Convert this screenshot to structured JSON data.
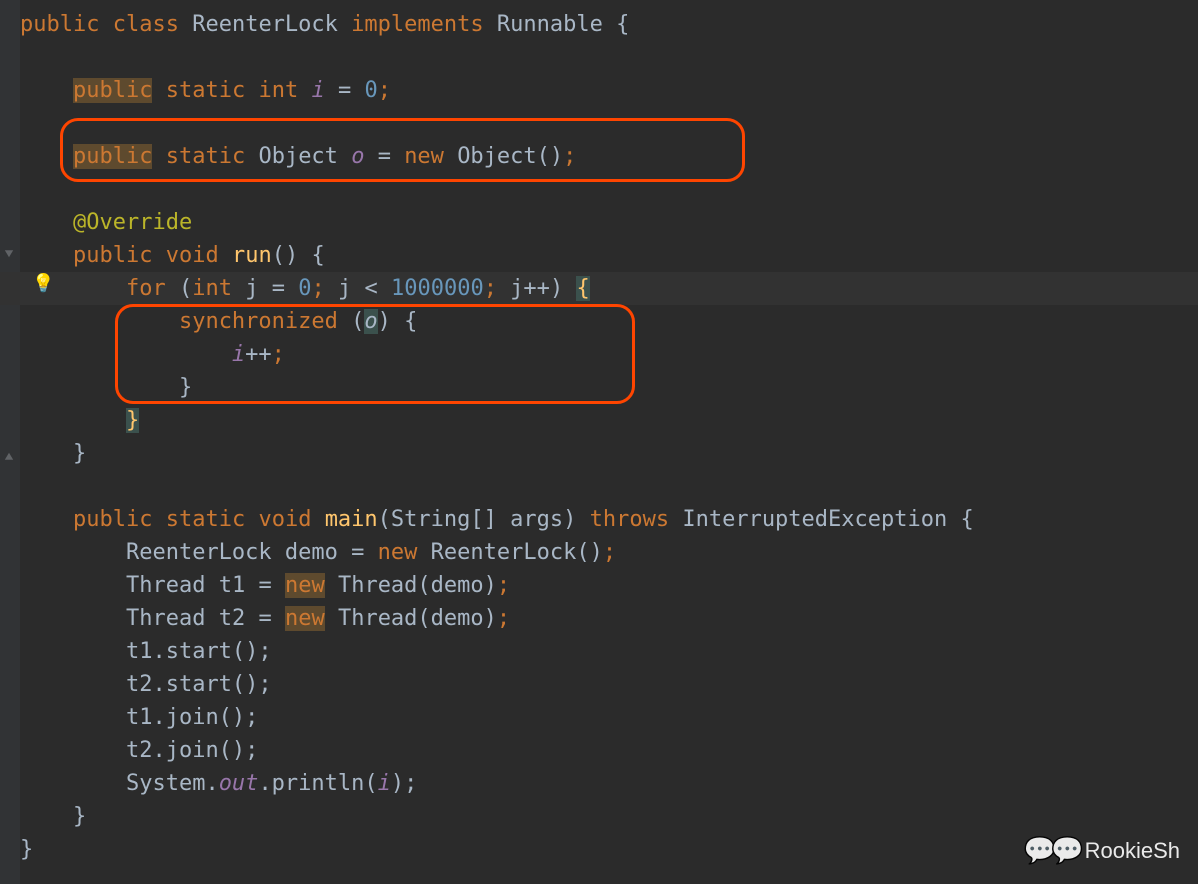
{
  "code": {
    "line1": {
      "kw_public": "public",
      "kw_class": "class",
      "class_name": "ReenterLock",
      "kw_implements": "implements",
      "iface": "Runnable",
      "brace": "{"
    },
    "line3": {
      "kw_public": "public",
      "kw_static": "static",
      "type": "int",
      "name": "i",
      "eq": "=",
      "val": "0",
      "semi": ";"
    },
    "line5": {
      "kw_public": "public",
      "kw_static": "static",
      "type": "Object",
      "name": "o",
      "eq": "=",
      "kw_new": "new",
      "ctor": "Object()",
      "semi": ";"
    },
    "line7": {
      "annotation": "@Override"
    },
    "line8": {
      "kw_public": "public",
      "kw_void": "void",
      "method": "run",
      "parens": "()",
      "brace": "{"
    },
    "line9": {
      "kw_for": "for",
      "open": "(",
      "kw_int": "int",
      "var": "j",
      "eq": "=",
      "zero": "0",
      "semi1": ";",
      "cond_var": "j",
      "lt": "<",
      "limit": "1000000",
      "semi2": ";",
      "inc": "j++",
      "close": ")",
      "brace": "{"
    },
    "line10": {
      "kw_sync": "synchronized",
      "open": "(",
      "var": "o",
      "close": ")",
      "brace": "{"
    },
    "line11": {
      "var": "i",
      "inc": "++",
      "semi": ";"
    },
    "line12": {
      "brace": "}"
    },
    "line13": {
      "brace": "}"
    },
    "line14": {
      "brace": "}"
    },
    "line16": {
      "kw_public": "public",
      "kw_static": "static",
      "kw_void": "void",
      "method": "main",
      "params": "(String[] args)",
      "kw_throws": "throws",
      "exc": "InterruptedException",
      "brace": "{"
    },
    "line17": {
      "type": "ReenterLock",
      "var": "demo",
      "eq": "=",
      "kw_new": "new",
      "ctor": "ReenterLock()",
      "semi": ";"
    },
    "line18": {
      "type": "Thread",
      "var": "t1",
      "eq": "=",
      "kw_new": "new",
      "ctor": "Thread(demo)",
      "semi": ";"
    },
    "line19": {
      "type": "Thread",
      "var": "t2",
      "eq": "=",
      "kw_new": "new",
      "ctor": "Thread(demo)",
      "semi": ";"
    },
    "line20": {
      "stmt": "t1.start();"
    },
    "line21": {
      "stmt": "t2.start();"
    },
    "line22": {
      "stmt": "t1.join();"
    },
    "line23": {
      "stmt": "t2.join();"
    },
    "line24": {
      "sys": "System.",
      "out": "out",
      "println": ".println(",
      "arg": "i",
      "close": ");"
    },
    "line25": {
      "brace": "}"
    },
    "line26": {
      "brace": "}"
    }
  },
  "watermark": "RookieSh",
  "colors": {
    "background": "#2b2b2b",
    "keyword": "#cc7832",
    "number": "#6897bb",
    "annotation": "#bbb529",
    "method": "#ffc66d",
    "text": "#a9b7c6",
    "static_field": "#9876aa",
    "highlight_box": "#ff4500"
  }
}
